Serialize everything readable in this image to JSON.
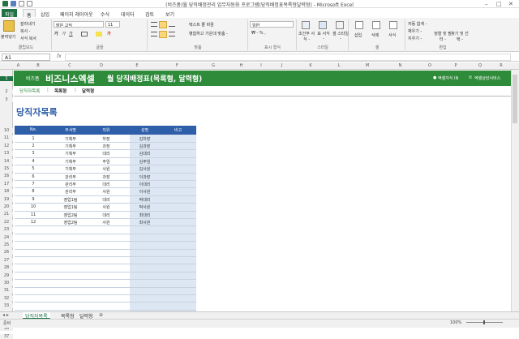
{
  "window": {
    "title": "(비즈폼)월 당직배정관리 업무자동화 프로그램(당직배정표목록형달력형) - Microsoft Excel"
  },
  "ribbon_tabs": [
    "파일",
    "홈",
    "삽입",
    "페이지 레이아웃",
    "수식",
    "데이터",
    "검토",
    "보기"
  ],
  "ribbon": {
    "paste": "붙여넣기",
    "cut": "잘라내기",
    "copy": "복사 -",
    "format_painter": "서식 복사",
    "font_name": "맑은 고딕",
    "font_size": "11",
    "wrap_text": "텍스트 줄 바꿈",
    "merge_center": "병합하고 가운데 맞춤 -",
    "number_format": "일반",
    "cond_format": "조건부 서식 -",
    "table_format": "표 서식 -",
    "cell_style": "셀 스타일 -",
    "insert": "삽입",
    "delete": "삭제",
    "format": "서식",
    "autosum": "자동 합계 -",
    "fill": "채우기 -",
    "clear": "지우기 -",
    "sort_filter": "정렬 및 필터 -",
    "find_select": "찾기 및 선택 -",
    "groups": [
      "클립보드",
      "글꼴",
      "맞춤",
      "표시 형식",
      "스타일",
      "셀",
      "편집"
    ]
  },
  "formula_bar": {
    "name_box": "A1",
    "fx": "fx",
    "value": ""
  },
  "columns": [
    "A",
    "B",
    "C",
    "D",
    "E",
    "F",
    "G",
    "H",
    "I",
    "J",
    "K",
    "L",
    "M",
    "N",
    "O",
    "P",
    "Q",
    "R"
  ],
  "banner": {
    "brand_small": "비즈폼",
    "brand": "비즈니스엑셀",
    "title": "월 당직배정표(목록형, 달력형)",
    "link1": "엑셀지식 IN",
    "link2": "엑셀상담서비스"
  },
  "nav": {
    "items": [
      "당직자목록",
      "목록형",
      "달력형"
    ],
    "sep": "|"
  },
  "page_title": "당직자목록",
  "table": {
    "headers": [
      "No.",
      "부서명",
      "직위",
      "성명",
      "비고"
    ],
    "rows": [
      [
        "1",
        "기획부",
        "차장",
        "김차장",
        ""
      ],
      [
        "2",
        "기획부",
        "과장",
        "김과장",
        ""
      ],
      [
        "3",
        "기획부",
        "대리",
        "김대리",
        ""
      ],
      [
        "4",
        "기획부",
        "주임",
        "김주임",
        ""
      ],
      [
        "5",
        "기획부",
        "사원",
        "김사원",
        ""
      ],
      [
        "6",
        "관리부",
        "과장",
        "이과장",
        ""
      ],
      [
        "7",
        "관리부",
        "대리",
        "이대리",
        ""
      ],
      [
        "8",
        "관리부",
        "사원",
        "이사원",
        ""
      ],
      [
        "9",
        "영업1팀",
        "대리",
        "박대리",
        ""
      ],
      [
        "10",
        "영업1팀",
        "사원",
        "박사원",
        ""
      ],
      [
        "11",
        "영업2팀",
        "대리",
        "최대리",
        ""
      ],
      [
        "12",
        "영업2팀",
        "사원",
        "최사원",
        ""
      ]
    ],
    "empty_rows": 13
  },
  "row_numbers": [
    "1",
    "2",
    "3",
    "10",
    "11",
    "12",
    "13",
    "14",
    "15",
    "16",
    "17",
    "18",
    "19",
    "20",
    "21",
    "22",
    "23",
    "24",
    "25",
    "26",
    "27",
    "28",
    "29",
    "30",
    "31",
    "32",
    "33",
    "34",
    "35",
    "36",
    "37"
  ],
  "sheet_tabs": [
    "당직자목록",
    "목록형",
    "달력형"
  ],
  "status": {
    "ready": "준비",
    "zoom": "100%"
  },
  "colors": {
    "brand_green": "#2e8b3a",
    "header_blue": "#2e5fa8",
    "excel_green": "#217346"
  }
}
